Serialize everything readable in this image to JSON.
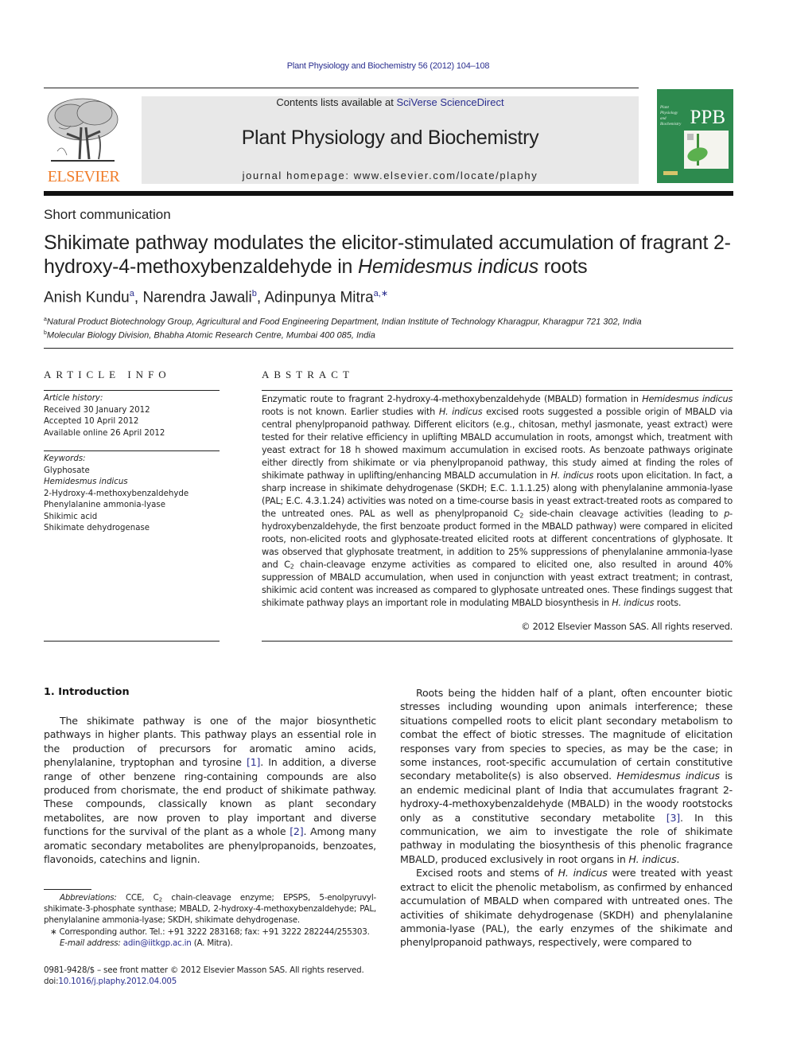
{
  "header": {
    "citation": "Plant Physiology and Biochemistry 56 (2012) 104–108",
    "contents_prefix": "Contents lists available at ",
    "contents_link": "SciVerse ScienceDirect",
    "journal_title": "Plant Physiology and Biochemistry",
    "homepage": "journal homepage: www.elsevier.com/locate/plaphy",
    "publisher_logo": "ELSEVIER",
    "cover_abbrev": "PPB",
    "cover_small_title": [
      "Plant",
      "Physiology",
      "and",
      "Biochemistry"
    ],
    "colors": {
      "link": "#2b2f8f",
      "elsevier_orange": "#f07d2a",
      "cover_green": "#2d8a4e",
      "banner_gray": "#e8e8e8"
    }
  },
  "article": {
    "type": "Short communication",
    "title_part1": "Shikimate pathway modulates the elicitor-stimulated accumulation of fragrant 2-hydroxy-4-methoxybenzaldehyde in ",
    "title_italic": "Hemidesmus indicus",
    "title_part2": " roots",
    "authors": [
      {
        "name": "Anish Kundu",
        "sup": "a",
        "sep": ", "
      },
      {
        "name": "Narendra Jawali",
        "sup": "b",
        "sep": ", "
      },
      {
        "name": "Adinpunya Mitra",
        "sup": "a,∗",
        "sep": ""
      }
    ],
    "affiliations": [
      {
        "sup": "a",
        "text": "Natural Product Biotechnology Group, Agricultural and Food Engineering Department, Indian Institute of Technology Kharagpur, Kharagpur 721 302, India"
      },
      {
        "sup": "b",
        "text": "Molecular Biology Division, Bhabha Atomic Research Centre, Mumbai 400 085, India"
      }
    ]
  },
  "article_info": {
    "heading": "ARTICLE INFO",
    "history_label": "Article history:",
    "history": [
      "Received 30 January 2012",
      "Accepted 10 April 2012",
      "Available online 26 April 2012"
    ],
    "keywords_label": "Keywords:",
    "keywords": [
      {
        "text": "Glyphosate",
        "italic": false
      },
      {
        "text": "Hemidesmus indicus",
        "italic": true
      },
      {
        "text": "2-Hydroxy-4-methoxybenzaldehyde",
        "italic": false
      },
      {
        "text": "Phenylalanine ammonia-lyase",
        "italic": false
      },
      {
        "text": "Shikimic acid",
        "italic": false
      },
      {
        "text": "Shikimate dehydrogenase",
        "italic": false
      }
    ]
  },
  "abstract": {
    "heading": "ABSTRACT",
    "segments": [
      {
        "t": "Enzymatic route to fragrant 2-hydroxy-4-methoxybenzaldehyde (MBALD) formation in "
      },
      {
        "t": "Hemidesmus indicus",
        "i": true
      },
      {
        "t": " roots is not known. Earlier studies with "
      },
      {
        "t": "H. indicus",
        "i": true
      },
      {
        "t": " excised roots suggested a possible origin of MBALD via central phenylpropanoid pathway. Different elicitors (e.g., chitosan, methyl jasmonate, yeast extract) were tested for their relative efficiency in uplifting MBALD accumulation in roots, amongst which, treatment with yeast extract for 18 h showed maximum accumulation in excised roots. As benzoate pathways originate either directly from shikimate or via phenylpropanoid pathway, this study aimed at finding the roles of shikimate pathway in uplifting/enhancing MBALD accumulation in "
      },
      {
        "t": "H. indicus",
        "i": true
      },
      {
        "t": " roots upon elicitation. In fact, a sharp increase in shikimate dehydrogenase (SKDH; E.C. 1.1.1.25) along with phenylalanine ammonia-lyase (PAL; E.C. 4.3.1.24) activities was noted on a time-course basis in yeast extract-treated roots as compared to the untreated ones. PAL as well as phenylpropanoid C"
      },
      {
        "t": "2",
        "sub": true
      },
      {
        "t": " side-chain cleavage activities (leading to "
      },
      {
        "t": "p",
        "i": true
      },
      {
        "t": "-hydroxybenzaldehyde, the first benzoate product formed in the MBALD pathway) were compared in elicited roots, non-elicited roots and glyphosate-treated elicited roots at different concentrations of glyphosate. It was observed that glyphosate treatment, in addition to 25% suppressions of phenylalanine ammonia-lyase and C"
      },
      {
        "t": "2",
        "sub": true
      },
      {
        "t": " chain-cleavage enzyme activities as compared to elicited one, also resulted in around 40% suppression of MBALD accumulation, when used in conjunction with yeast extract treatment; in contrast, shikimic acid content was increased as compared to glyphosate untreated ones. These findings suggest that shikimate pathway plays an important role in modulating MBALD biosynthesis in "
      },
      {
        "t": "H. indicus",
        "i": true
      },
      {
        "t": " roots."
      }
    ],
    "copyright": "© 2012 Elsevier Masson SAS. All rights reserved."
  },
  "introduction": {
    "heading": "1.  Introduction",
    "col1_paragraphs": [
      [
        {
          "t": "The shikimate pathway is one of the major biosynthetic pathways in higher plants. This pathway plays an essential role in the production of precursors for aromatic amino acids, phenylalanine, tryptophan and tyrosine "
        },
        {
          "t": "[1]",
          "link": true
        },
        {
          "t": ". In addition, a diverse range of other benzene ring-containing compounds are also produced from chorismate, the end product of shikimate pathway. These compounds, classically known as plant secondary metabolites, are now proven to play important and diverse functions for the survival of the plant as a whole "
        },
        {
          "t": "[2]",
          "link": true
        },
        {
          "t": ". Among many aromatic secondary metabolites are phenylpropanoids, benzoates, flavonoids, catechins and lignin."
        }
      ]
    ],
    "col2_paragraphs": [
      [
        {
          "t": "Roots being the hidden half of a plant, often encounter biotic stresses including wounding upon animals interference; these situations compelled roots to elicit plant secondary metabolism to combat the effect of biotic stresses. The magnitude of elicitation responses vary from species to species, as may be the case; in some instances, root-specific accumulation of certain constitutive secondary metabolite(s) is also observed. "
        },
        {
          "t": "Hemidesmus indicus",
          "i": true
        },
        {
          "t": " is an endemic medicinal plant of India that accumulates fragrant 2-hydroxy-4-methoxybenzaldehyde (MBALD) in the woody rootstocks only as a constitutive secondary metabolite "
        },
        {
          "t": "[3]",
          "link": true
        },
        {
          "t": ". In this communication, we aim to investigate the role of shikimate pathway in modulating the biosynthesis of this phenolic fragrance MBALD, produced exclusively in root organs in "
        },
        {
          "t": "H. indicus",
          "i": true
        },
        {
          "t": "."
        }
      ],
      [
        {
          "t": "Excised roots and stems of "
        },
        {
          "t": "H. indicus",
          "i": true
        },
        {
          "t": " were treated with yeast extract to elicit the phenolic metabolism, as confirmed by enhanced accumulation of MBALD when compared with untreated ones. The activities of shikimate dehydrogenase (SKDH) and phenylalanine ammonia-lyase (PAL), the early enzymes of the shikimate and phenylpropanoid pathways, respectively, were compared to"
        }
      ]
    ]
  },
  "footnotes": {
    "abbreviations": [
      {
        "t": "Abbreviations:",
        "i": true
      },
      {
        "t": " CCE, C"
      },
      {
        "t": "2",
        "sub": true
      },
      {
        "t": " chain-cleavage enzyme; EPSPS, 5-enolpyruvyl-shikimate-3-phosphate synthase; MBALD, 2-hydroxy-4-methoxybenzaldehyde; PAL, phenylalanine ammonia-lyase; SKDH, shikimate dehydrogenase."
      }
    ],
    "corresponding": "∗ Corresponding author. Tel.: +91 3222 283168; fax: +91 3222 282244/255303.",
    "email_label": "E-mail address:",
    "email": "adin@iitkgp.ac.in",
    "email_suffix": " (A. Mitra).",
    "front_matter": "0981-9428/$ – see front matter © 2012 Elsevier Masson SAS. All rights reserved.",
    "doi_prefix": "doi:",
    "doi": "10.1016/j.plaphy.2012.04.005"
  }
}
